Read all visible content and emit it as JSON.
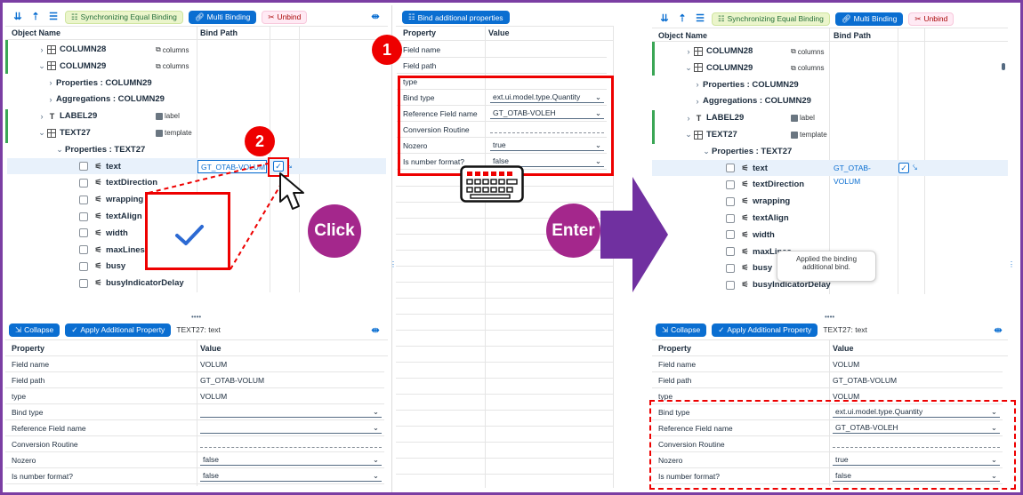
{
  "colors": {
    "frame": "#7b3ea3",
    "accent": "#0a6ed1",
    "highlight": "#e00",
    "click": "#a4278c",
    "arrow": "#7030a0"
  },
  "left_panel": {
    "toolbar": {
      "sync": "Synchronizing Equal Binding",
      "multi": "Multi Binding",
      "unbind": "Unbind"
    },
    "headers": {
      "object": "Object Name",
      "bind": "Bind Path"
    },
    "rows": [
      {
        "label": "COLUMN28",
        "tag": "columns"
      },
      {
        "label": "COLUMN29",
        "tag": "columns"
      },
      {
        "label": "Properties : COLUMN29"
      },
      {
        "label": "Aggregations : COLUMN29"
      },
      {
        "label": "LABEL29",
        "tag": "label"
      },
      {
        "label": "TEXT27",
        "tag": "template"
      },
      {
        "label": "Properties : TEXT27"
      },
      {
        "label": "text",
        "value": "GT_OTAB-VOLUM"
      },
      {
        "label": "textDirection"
      },
      {
        "label": "wrapping"
      },
      {
        "label": "textAlign"
      },
      {
        "label": "width"
      },
      {
        "label": "maxLines"
      },
      {
        "label": "busy"
      },
      {
        "label": "busyIndicatorDelay"
      }
    ],
    "bottom": {
      "collapse": "Collapse",
      "apply": "Apply Additional Property",
      "context": "TEXT27: text",
      "headers": {
        "property": "Property",
        "value": "Value"
      },
      "rows": [
        {
          "property": "Field name",
          "value": "VOLUM"
        },
        {
          "property": "Field path",
          "value": "GT_OTAB-VOLUM"
        },
        {
          "property": "type",
          "value": "VOLUM"
        },
        {
          "property": "Bind type",
          "value": ""
        },
        {
          "property": "Reference Field name",
          "value": ""
        },
        {
          "property": "Conversion Routine",
          "value": ""
        },
        {
          "property": "Nozero",
          "value": "false"
        },
        {
          "property": "Is number format?",
          "value": "false"
        }
      ]
    }
  },
  "middle_panel": {
    "button": "Bind additional properties",
    "headers": {
      "property": "Property",
      "value": "Value"
    },
    "rows": [
      {
        "property": "Field name",
        "value": ""
      },
      {
        "property": "Field path",
        "value": ""
      },
      {
        "property": "type",
        "value": ""
      },
      {
        "property": "Bind type",
        "value": "ext.ui.model.type.Quantity"
      },
      {
        "property": "Reference Field name",
        "value": "GT_OTAB-VOLEH"
      },
      {
        "property": "Conversion Routine",
        "value": ""
      },
      {
        "property": "Nozero",
        "value": "true"
      },
      {
        "property": "Is number format?",
        "value": "false"
      }
    ]
  },
  "right_panel": {
    "toolbar": {
      "sync": "Synchronizing Equal Binding",
      "multi": "Multi Binding",
      "unbind": "Unbind"
    },
    "headers": {
      "object": "Object Name",
      "bind": "Bind Path"
    },
    "rows": [
      {
        "label": "COLUMN28",
        "tag": "columns"
      },
      {
        "label": "COLUMN29",
        "tag": "columns"
      },
      {
        "label": "Properties : COLUMN29"
      },
      {
        "label": "Aggregations : COLUMN29"
      },
      {
        "label": "LABEL29",
        "tag": "label"
      },
      {
        "label": "TEXT27",
        "tag": "template"
      },
      {
        "label": "Properties : TEXT27"
      },
      {
        "label": "text",
        "value": "GT_OTAB-VOLUM"
      },
      {
        "label": "textDirection"
      },
      {
        "label": "wrapping"
      },
      {
        "label": "textAlign"
      },
      {
        "label": "width"
      },
      {
        "label": "maxLines"
      },
      {
        "label": "busy"
      },
      {
        "label": "busyIndicatorDelay"
      }
    ],
    "toast": {
      "line1": "Applied the binding",
      "line2": "additional bind."
    },
    "bottom": {
      "collapse": "Collapse",
      "apply": "Apply Additional Property",
      "context": "TEXT27: text",
      "headers": {
        "property": "Property",
        "value": "Value"
      },
      "rows": [
        {
          "property": "Field name",
          "value": "VOLUM"
        },
        {
          "property": "Field path",
          "value": "GT_OTAB-VOLUM"
        },
        {
          "property": "type",
          "value": "VOLUM"
        },
        {
          "property": "Bind type",
          "value": "ext.ui.model.type.Quantity"
        },
        {
          "property": "Reference Field name",
          "value": "GT_OTAB-VOLEH"
        },
        {
          "property": "Conversion Routine",
          "value": ""
        },
        {
          "property": "Nozero",
          "value": "true"
        },
        {
          "property": "Is number format?",
          "value": "false"
        }
      ]
    }
  },
  "annotations": {
    "step1": "1",
    "step2": "2",
    "click": "Click",
    "enter": "Enter"
  }
}
